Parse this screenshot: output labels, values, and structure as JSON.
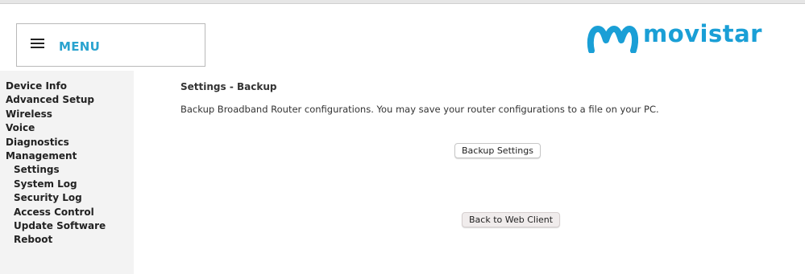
{
  "header": {
    "menu_label": "MENU",
    "brand_name": "movistar",
    "brand_color": "#1a9fd6",
    "menu_color": "#2aa3cf"
  },
  "sidebar": {
    "items": [
      {
        "label": "Device Info",
        "level": 0
      },
      {
        "label": "Advanced Setup",
        "level": 0
      },
      {
        "label": "Wireless",
        "level": 0
      },
      {
        "label": "Voice",
        "level": 0
      },
      {
        "label": "Diagnostics",
        "level": 0
      },
      {
        "label": "Management",
        "level": 0
      },
      {
        "label": "Settings",
        "level": 1
      },
      {
        "label": "System Log",
        "level": 1
      },
      {
        "label": "Security Log",
        "level": 1
      },
      {
        "label": "Access Control",
        "level": 1
      },
      {
        "label": "Update Software",
        "level": 1
      },
      {
        "label": "Reboot",
        "level": 1
      }
    ]
  },
  "main": {
    "title": "Settings - Backup",
    "description": "Backup Broadband Router configurations. You may save your router configurations to a file on your PC.",
    "backup_button": "Backup Settings",
    "back_button": "Back to Web Client"
  },
  "icons": {
    "menu": "hamburger-icon",
    "logo": "movistar-m-logo"
  }
}
